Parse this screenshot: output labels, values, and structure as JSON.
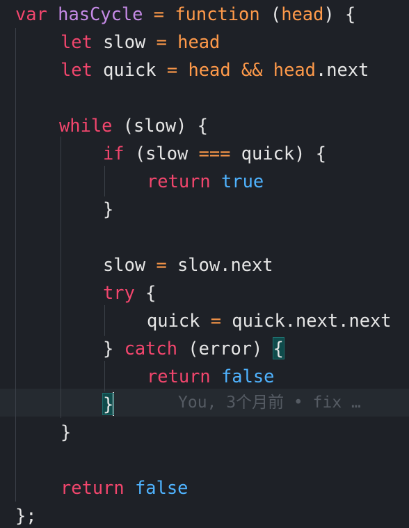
{
  "editor": {
    "language": "javascript",
    "blame": "You, 3个月前 • fix …",
    "lines": [
      {
        "tokens": [
          {
            "c": "k",
            "t": "var"
          },
          {
            "c": "t",
            "t": " "
          },
          {
            "c": "f",
            "t": "hasCycle"
          },
          {
            "c": "t",
            "t": " "
          },
          {
            "c": "o",
            "t": "="
          },
          {
            "c": "t",
            "t": " "
          },
          {
            "c": "o",
            "t": "function"
          },
          {
            "c": "t",
            "t": " ("
          },
          {
            "c": "o",
            "t": "head"
          },
          {
            "c": "t",
            "t": ") {"
          }
        ]
      },
      {
        "tokens": [
          {
            "c": "k",
            "t": "let"
          },
          {
            "c": "t",
            "t": " slow "
          },
          {
            "c": "o",
            "t": "="
          },
          {
            "c": "t",
            "t": " "
          },
          {
            "c": "o",
            "t": "head"
          }
        ]
      },
      {
        "tokens": [
          {
            "c": "k",
            "t": "let"
          },
          {
            "c": "t",
            "t": " quick "
          },
          {
            "c": "o",
            "t": "="
          },
          {
            "c": "t",
            "t": " "
          },
          {
            "c": "o",
            "t": "head"
          },
          {
            "c": "t",
            "t": " "
          },
          {
            "c": "o",
            "t": "&&"
          },
          {
            "c": "t",
            "t": " "
          },
          {
            "c": "o",
            "t": "head"
          },
          {
            "c": "t",
            "t": ".next"
          }
        ]
      },
      {
        "tokens": []
      },
      {
        "tokens": [
          {
            "c": "k",
            "t": "while"
          },
          {
            "c": "t",
            "t": " (slow) {"
          }
        ]
      },
      {
        "tokens": [
          {
            "c": "k",
            "t": "if"
          },
          {
            "c": "t",
            "t": " (slow "
          },
          {
            "c": "o",
            "t": "==="
          },
          {
            "c": "t",
            "t": " quick) {"
          }
        ]
      },
      {
        "tokens": [
          {
            "c": "k",
            "t": "return"
          },
          {
            "c": "t",
            "t": " "
          },
          {
            "c": "b",
            "t": "true"
          }
        ]
      },
      {
        "tokens": [
          {
            "c": "t",
            "t": "}"
          }
        ]
      },
      {
        "tokens": []
      },
      {
        "tokens": [
          {
            "c": "t",
            "t": "slow "
          },
          {
            "c": "o",
            "t": "="
          },
          {
            "c": "t",
            "t": " slow.next"
          }
        ]
      },
      {
        "tokens": [
          {
            "c": "k",
            "t": "try"
          },
          {
            "c": "t",
            "t": " {"
          }
        ]
      },
      {
        "tokens": [
          {
            "c": "t",
            "t": "quick "
          },
          {
            "c": "o",
            "t": "="
          },
          {
            "c": "t",
            "t": " quick.next.next"
          }
        ]
      },
      {
        "tokens": [
          {
            "c": "t",
            "t": "} "
          },
          {
            "c": "k",
            "t": "catch"
          },
          {
            "c": "t",
            "t": " (error) "
          },
          {
            "c": "t",
            "t": "{",
            "hl": true
          }
        ]
      },
      {
        "tokens": [
          {
            "c": "k",
            "t": "return"
          },
          {
            "c": "t",
            "t": " "
          },
          {
            "c": "b",
            "t": "false"
          }
        ]
      },
      {
        "tokens": [
          {
            "c": "t",
            "t": "}",
            "hl": true,
            "caret": true
          }
        ]
      },
      {
        "tokens": [
          {
            "c": "t",
            "t": "}"
          }
        ]
      },
      {
        "tokens": []
      },
      {
        "tokens": [
          {
            "c": "k",
            "t": "return"
          },
          {
            "c": "t",
            "t": " "
          },
          {
            "c": "b",
            "t": "false"
          }
        ]
      },
      {
        "tokens": [
          {
            "c": "t",
            "t": "};"
          }
        ]
      }
    ]
  }
}
